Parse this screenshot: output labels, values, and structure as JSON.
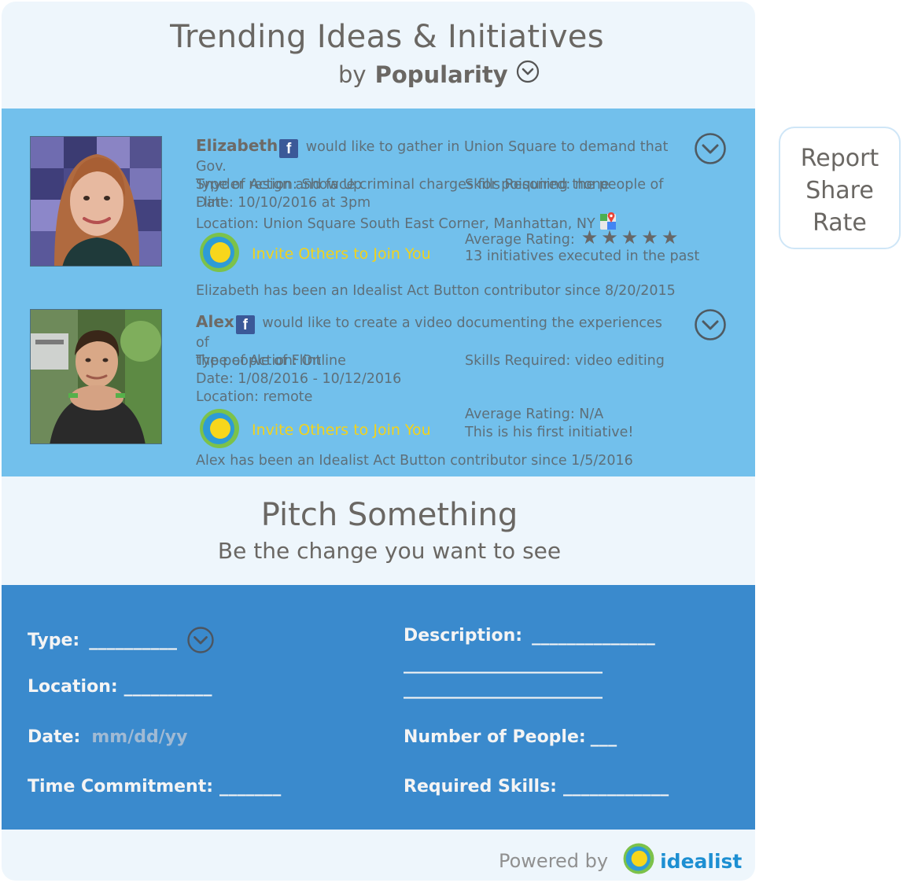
{
  "header": {
    "title": "Trending Ideas & Initiatives",
    "sort_prefix": "by",
    "sort_value": "Popularity"
  },
  "initiatives": [
    {
      "name": "Elizabeth",
      "description_line1": "would like to gather in Union Square to demand that Gov.",
      "description_line2": "Snyder resign and face criminal charges for poisoning the people of Flint",
      "type_of_action": "Type of Action: Show Up",
      "skills_required": "Skills Required: none",
      "date": "Date: 10/10/2016 at 3pm",
      "location": "Location: Union Square South East Corner, Manhattan, NY",
      "invite_label": "Invite Others to Join You",
      "average_rating_label": "Average Rating:",
      "rating_stars": 5,
      "history": "13 initiatives executed in the past",
      "contributor_note": "Elizabeth has been an Idealist Act Button contributor since 8/20/2015"
    },
    {
      "name": "Alex",
      "description_line1": "would like to create a video documenting the experiences of",
      "description_line2": "the people of Flint",
      "type_of_action": "Type of Action: Online",
      "skills_required": "Skills Required: video editing",
      "date": "Date: 1/08/2016 - 10/12/2016",
      "location": "Location: remote",
      "invite_label": "Invite Others to Join You",
      "average_rating_label": "Average Rating: N/A",
      "history": "This is his first initiative!",
      "contributor_note": "Alex has been an Idealist Act Button contributor since 1/5/2016"
    }
  ],
  "side_menu": {
    "report": "Report",
    "share": "Share",
    "rate": "Rate"
  },
  "pitch": {
    "title": "Pitch Something",
    "subtitle": "Be the change you want to see"
  },
  "form": {
    "type_label": "Type:",
    "type_blank": "__________",
    "location_label": "Location:",
    "location_blank": "__________",
    "date_label": "Date:",
    "date_placeholder": "mm/dd/yy",
    "time_label": "Time Commitment:",
    "time_blank": "_______",
    "description_label": "Description:",
    "description_blank1": "______________",
    "description_blank2": "_______________________",
    "description_blank3": "_______________________",
    "people_label": "Number of People:",
    "people_blank": "___",
    "skills_label": "Required Skills:",
    "skills_blank": "____________"
  },
  "footer": {
    "powered_by": "Powered by",
    "brand": "idealist"
  },
  "colors": {
    "trending_bg": "#72c0ec",
    "form_bg": "#3a8acd",
    "panel_bg": "#eef6fc",
    "invite_text": "#f3d21a",
    "brand_blue": "#1d8fd2",
    "facebook_blue": "#3b5998"
  }
}
